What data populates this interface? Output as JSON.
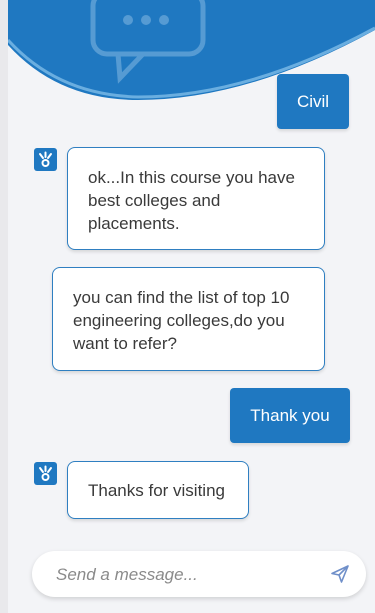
{
  "messages": [
    {
      "from": "user",
      "text": "Civil"
    },
    {
      "from": "bot",
      "text": "ok...In this course you have best colleges and placements."
    },
    {
      "from": "bot",
      "text": "you can find the list of top 10 engineering colleges,do you want to refer?"
    },
    {
      "from": "user",
      "text": "Thank you"
    },
    {
      "from": "bot",
      "text": "Thanks for visiting"
    }
  ],
  "composer": {
    "placeholder": "Send a message..."
  },
  "icons": {
    "header": "speech-bubble-icon",
    "avatar": "bot-avatar-icon",
    "send": "send-icon"
  },
  "colors": {
    "accent": "#1f78c1",
    "bubble_border": "#2f7fc1"
  }
}
